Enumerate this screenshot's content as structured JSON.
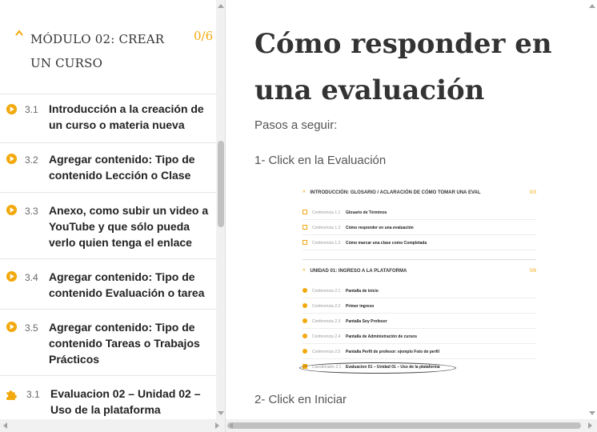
{
  "colors": {
    "accent": "#f2a90d",
    "text": "#222222",
    "muted": "#666666"
  },
  "sidebar": {
    "module_title": "MÓDULO 02: CREAR UN CURSO",
    "module_progress": "0/6",
    "lessons": [
      {
        "number": "3.1",
        "title": "Introducción a la creación de un curso o materia nueva",
        "icon": "play-circle-icon"
      },
      {
        "number": "3.2",
        "title": "Agregar contenido: Tipo de contenido Lección o Clase",
        "icon": "play-circle-icon"
      },
      {
        "number": "3.3",
        "title": "Anexo, como subir un video a YouTube y que sólo pueda verlo quien tenga el enlace",
        "icon": "play-circle-icon"
      },
      {
        "number": "3.4",
        "title": "Agregar contenido: Tipo de contenido Evaluación o tarea",
        "icon": "play-circle-icon"
      },
      {
        "number": "3.5",
        "title": "Agregar contenido: Tipo de contenido Tareas o Trabajos Prácticos",
        "icon": "play-circle-icon"
      },
      {
        "number": "3.1",
        "title": "Evaluacion 02 – Unidad 02 – Uso de la plataforma",
        "icon": "puzzle-icon"
      }
    ]
  },
  "content": {
    "title": "Cómo responder en una evaluación",
    "steps_intro": "Pasos a seguir:",
    "step1": "1- Click en la Evaluación",
    "step2": "2- Click en Iniciar",
    "screenshot": {
      "section1": {
        "title": "INTRODUCCIÓN: GLOSARIO / ACLARACIÓN DE CÓMO TOMAR UNA EVAL",
        "progress": "0/3",
        "rows": [
          {
            "kind": "Conferencia",
            "num": "1.1",
            "title": "Glosario de Términos"
          },
          {
            "kind": "Conferencia",
            "num": "1.2",
            "title": "Cómo responder en una evaluación"
          },
          {
            "kind": "Conferencia",
            "num": "1.3",
            "title": "Cómo marcar una clase como Completada"
          }
        ]
      },
      "section2": {
        "title": "UNIDAD 01: INGRESO A LA PLATAFORMA",
        "progress": "0/6",
        "rows": [
          {
            "kind": "Conferencia",
            "num": "2.1",
            "title": "Pantalla de inicio"
          },
          {
            "kind": "Conferencia",
            "num": "2.2",
            "title": "Primer ingreso"
          },
          {
            "kind": "Conferencia",
            "num": "2.3",
            "title": "Pantalla Soy Profesor"
          },
          {
            "kind": "Conferencia",
            "num": "2.4",
            "title": "Pantalla de Administración de cursos"
          },
          {
            "kind": "Conferencia",
            "num": "2.5",
            "title": "Pantalla Perfil de profesor: ejemplo Foto de perfil"
          },
          {
            "kind": "Cuestionario",
            "num": "2.1",
            "title": "Evaluacion 01 – Unidad 01 – Uso de la plataforma"
          }
        ]
      }
    }
  }
}
